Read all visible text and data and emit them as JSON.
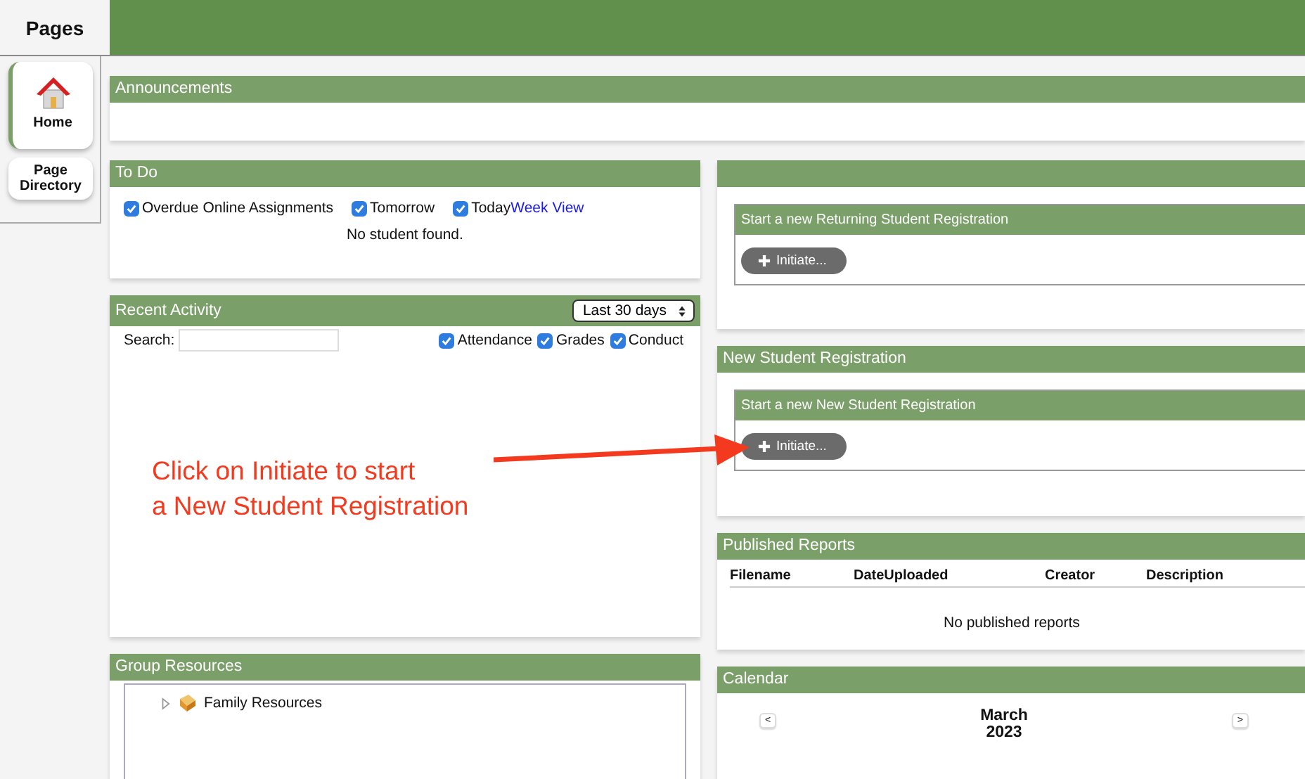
{
  "sidebar": {
    "title": "Pages",
    "items": [
      {
        "label": "Home",
        "kind": "home",
        "selected": true
      },
      {
        "label": "Page Directory",
        "kind": "plain",
        "selected": false
      }
    ]
  },
  "announcements": {
    "title": "Announcements"
  },
  "todo": {
    "title": "To Do",
    "filters": [
      {
        "label": "Overdue Online Assignments",
        "checked": true
      },
      {
        "label": "Tomorrow",
        "checked": true
      },
      {
        "label": "Today",
        "checked": true
      }
    ],
    "link": "Week View",
    "message": "No student found."
  },
  "recent_activity": {
    "title": "Recent Activity",
    "range": "Last 30 days",
    "search_label": "Search:",
    "filters": [
      {
        "label": "Attendance",
        "checked": true
      },
      {
        "label": "Grades",
        "checked": true
      },
      {
        "label": "Conduct",
        "checked": true
      }
    ]
  },
  "group_resources": {
    "title": "Group Resources",
    "tree": [
      {
        "label": "Family Resources",
        "expanded": false
      }
    ]
  },
  "returning_registration": {
    "form": {
      "title": "Start a new Returning Student Registration",
      "button": "Initiate..."
    }
  },
  "new_registration": {
    "title": "New Student Registration",
    "form": {
      "title": "Start a new New Student Registration",
      "button": "Initiate..."
    }
  },
  "published_reports": {
    "title": "Published Reports",
    "columns": [
      "Filename",
      "DateUploaded",
      "Creator",
      "Description"
    ],
    "message": "No published reports"
  },
  "calendar": {
    "title": "Calendar",
    "month": "March",
    "year": "2023",
    "prev": "<",
    "next": ">"
  },
  "annotation": {
    "lines": [
      "Click on Initiate to start",
      "a New Student Registration"
    ]
  }
}
